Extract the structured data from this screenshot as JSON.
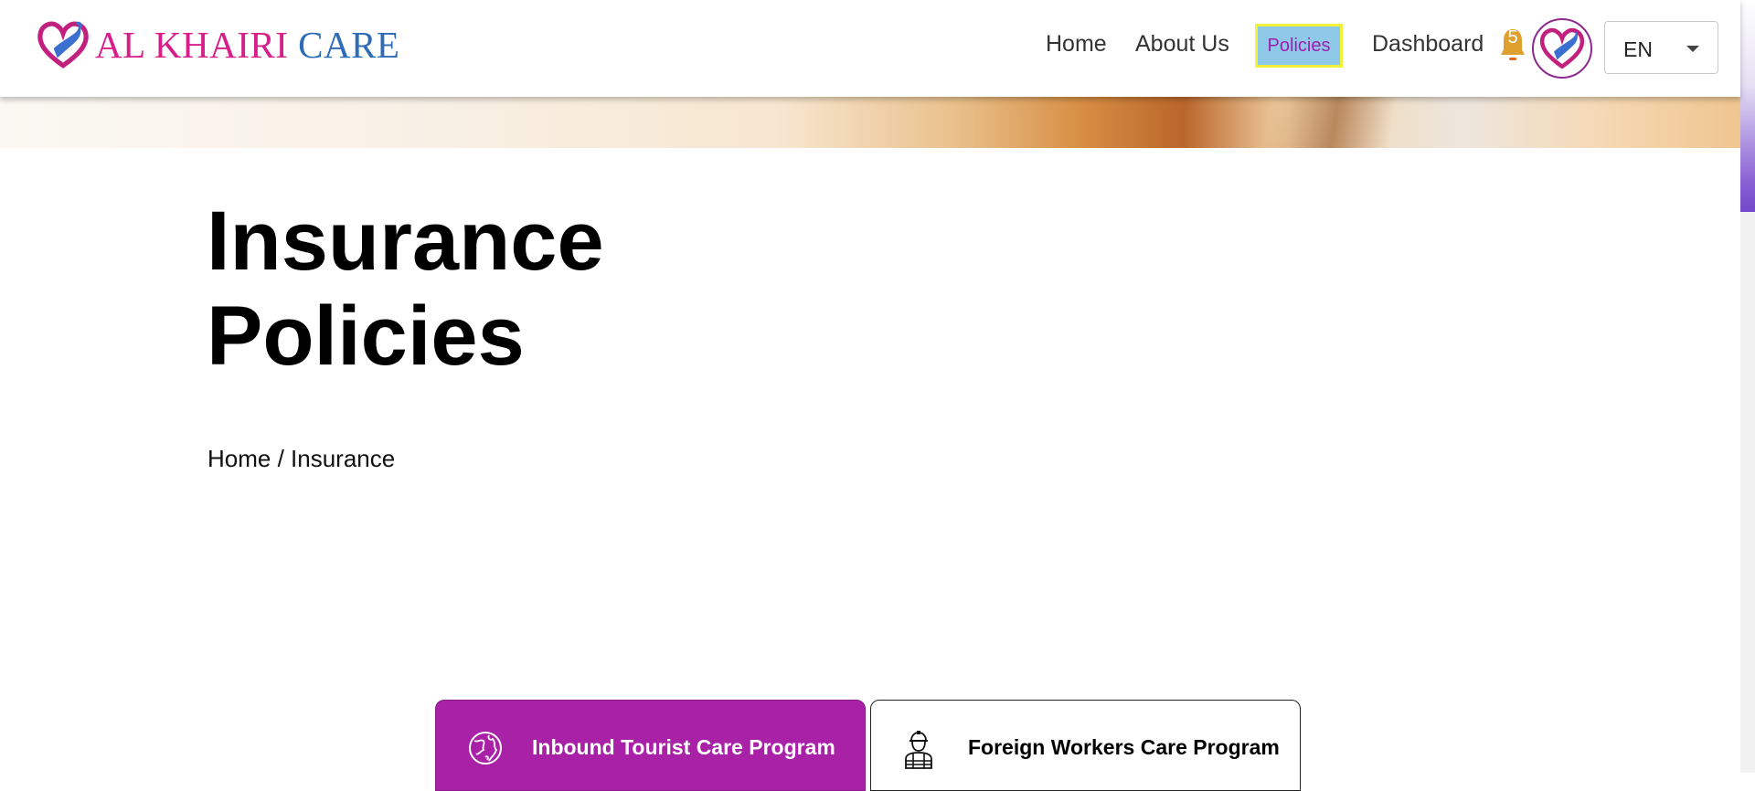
{
  "brand": {
    "name_part1": "AL KHAIRI",
    "name_part2": "CARE",
    "colors": {
      "magenta": "#d81e8a",
      "blue": "#2e6cb8",
      "purple": "#a821a6"
    }
  },
  "nav": {
    "items": [
      {
        "label": "Home"
      },
      {
        "label": "About Us"
      },
      {
        "label": "Policies",
        "active": true
      },
      {
        "label": "Dashboard"
      }
    ],
    "notifications_count": "5",
    "notification_icon": "bell-icon",
    "avatar_icon": "heart-hands-logo"
  },
  "language": {
    "selected": "EN"
  },
  "page": {
    "title_line1": "Insurance",
    "title_line2": "Policies",
    "breadcrumb": {
      "home": "Home",
      "separator": " / ",
      "current": "Insurance"
    }
  },
  "programs": {
    "tabs": [
      {
        "label": "Inbound Tourist Care Program",
        "icon": "globe-icon",
        "active": true
      },
      {
        "label": "Foreign Workers Care Program",
        "icon": "worker-icon",
        "active": false
      }
    ]
  }
}
